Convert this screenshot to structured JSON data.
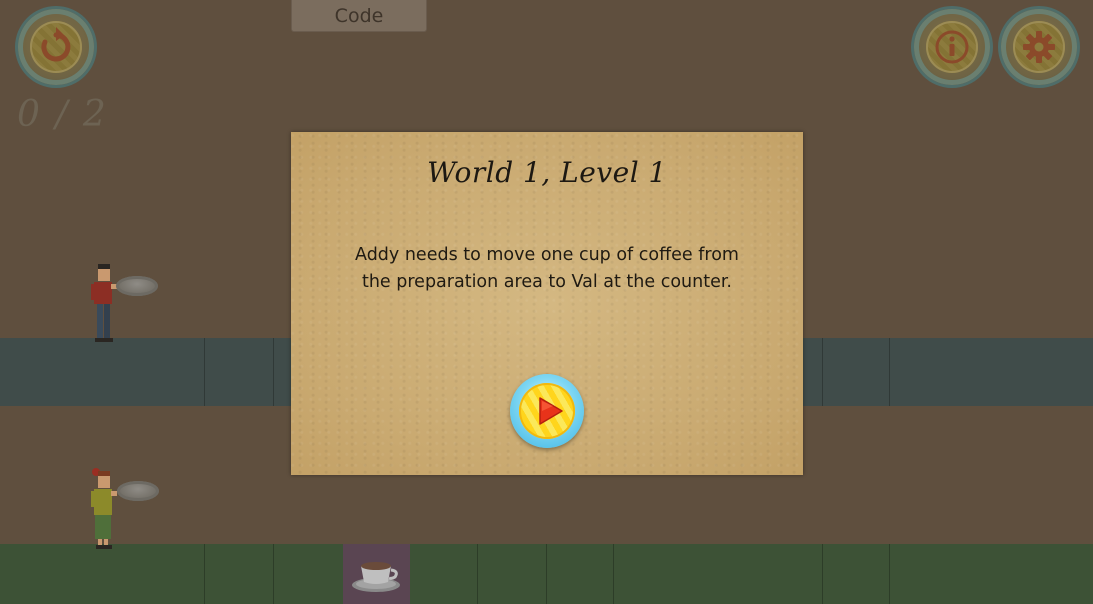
{
  "toolbar": {
    "code_tab_label": "Code",
    "restart_icon": "restart-icon",
    "info_icon": "info-icon",
    "settings_icon": "gear-icon"
  },
  "hud": {
    "score": "0 / 2"
  },
  "dialog": {
    "title": "World 1, Level 1",
    "description": "Addy needs to move one cup of coffee from the preparation area to Val at the counter.",
    "play_icon": "play-icon"
  },
  "scene": {
    "characters": [
      "addy",
      "val"
    ],
    "item": "coffee-cup"
  },
  "colors": {
    "background": "#5f4f3e",
    "counter_lane": "#404c4a",
    "prep_lane": "#3d5236",
    "dialog_paper": "#c9a970",
    "play_button_ring": "#3eb5e3",
    "play_button_fill": "#ffd51c"
  }
}
